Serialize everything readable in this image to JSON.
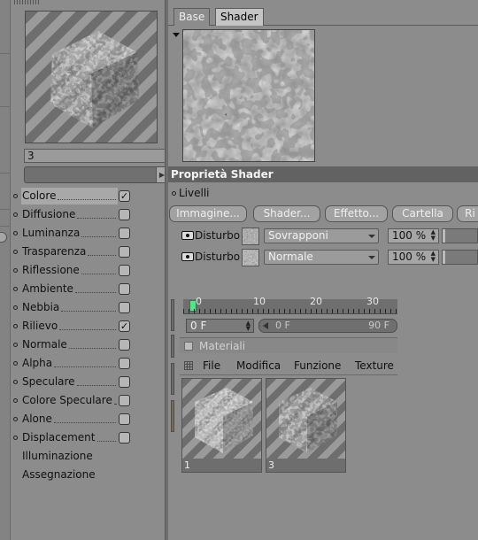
{
  "material_preview": {
    "name": "3"
  },
  "channels": [
    {
      "label": "Colore",
      "checked": true,
      "selected": true
    },
    {
      "label": "Diffusione",
      "checked": false
    },
    {
      "label": "Luminanza",
      "checked": false
    },
    {
      "label": "Trasparenza",
      "checked": false
    },
    {
      "label": "Riflessione",
      "checked": false
    },
    {
      "label": "Ambiente",
      "checked": false
    },
    {
      "label": "Nebbia",
      "checked": false
    },
    {
      "label": "Rilievo",
      "checked": true
    },
    {
      "label": "Normale",
      "checked": false
    },
    {
      "label": "Alpha",
      "checked": false
    },
    {
      "label": "Speculare",
      "checked": false
    },
    {
      "label": "Colore Speculare",
      "checked": false
    },
    {
      "label": "Alone",
      "checked": false
    },
    {
      "label": "Displacement",
      "checked": false
    }
  ],
  "extra_items": [
    "Illuminazione",
    "Assegnazione"
  ],
  "tabs": {
    "base": "Base",
    "shader": "Shader",
    "active": "shader"
  },
  "shader": {
    "header": "Proprietà Shader",
    "layers_label": "Livelli",
    "buttons": {
      "image": "Immagine...",
      "shader": "Shader...",
      "effect": "Effetto...",
      "folder": "Cartella",
      "rimuovi": "Ri"
    },
    "layers": [
      {
        "name": "Disturbo",
        "mode": "Sovrapponi",
        "opacity": "100 %"
      },
      {
        "name": "Disturbo",
        "mode": "Normale",
        "opacity": "100 %"
      }
    ]
  },
  "timeline": {
    "ruler_labels": [
      "0",
      "10",
      "20",
      "30"
    ],
    "current_frame": "0 F",
    "range_start": "0 F",
    "range_end": "90 F"
  },
  "materials": {
    "title": "Materiali",
    "menu": [
      "File",
      "Modifica",
      "Funzione",
      "Texture"
    ],
    "items": [
      {
        "label": "1"
      },
      {
        "label": "3"
      }
    ]
  },
  "colors": {
    "accent_marker": "#5ce08a",
    "panel_bg": "#8c8c8c",
    "header_bg": "#626262"
  }
}
